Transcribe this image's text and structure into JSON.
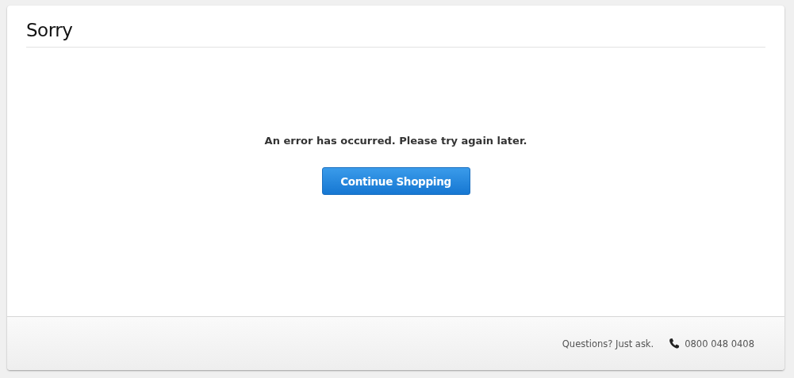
{
  "heading": "Sorry",
  "message": "An error has occurred. Please try again later.",
  "button": "Continue Shopping",
  "footer": {
    "question": "Questions? Just ask.",
    "phone": "0800 048 0408"
  }
}
